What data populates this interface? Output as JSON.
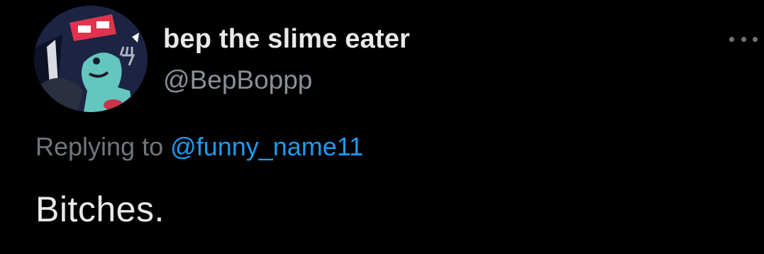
{
  "tweet": {
    "author": {
      "display_name": "bep the slime eater",
      "handle": "@BepBoppp",
      "avatar_icon": "avatar-image"
    },
    "more_icon": "more-horizontal-icon",
    "reply_context": {
      "prefix": "Replying to",
      "mention": "@funny_name11"
    },
    "text": "Bitches."
  },
  "colors": {
    "background": "#000000",
    "primary_text": "#e7e9ea",
    "secondary_text": "#71767b",
    "link": "#1d9bf0"
  }
}
